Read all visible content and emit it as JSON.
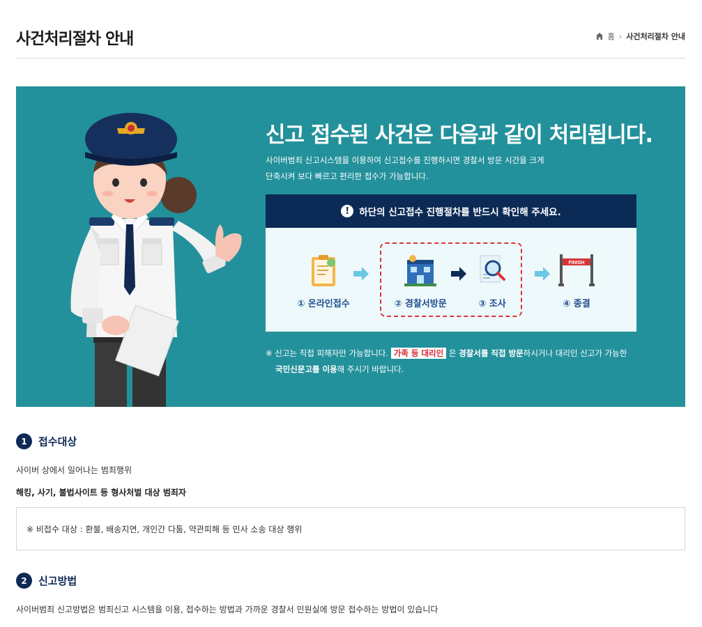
{
  "header": {
    "title": "사건처리절차 안내",
    "breadcrumb": {
      "home": "홈",
      "current": "사건처리절차 안내"
    }
  },
  "banner": {
    "title": "신고 접수된 사건은 다음과 같이 처리됩니다.",
    "desc_line1": "사이버범죄 신고시스템을 이용하여 신고접수를 진행하시면 경찰서 방문 시간을 크게",
    "desc_line2": "단축시켜 보다 빠르고 편리한 접수가 가능합니다.",
    "process_notice": "하단의 신고접수 진행절차를 반드시 확인해 주세요.",
    "alert_glyph": "!",
    "steps": [
      {
        "label": "① 온라인접수",
        "icon": "clipboard-icon"
      },
      {
        "label": "② 경찰서방문",
        "icon": "police-station-icon"
      },
      {
        "label": "③ 조사",
        "icon": "magnifier-document-icon"
      },
      {
        "label": "④ 종결",
        "icon": "finish-line-icon"
      }
    ],
    "finish_text": "FINISH",
    "note": {
      "part1": "※ 신고는 직접 피해자만 가능합니다.",
      "highlight": "가족 등 대리인",
      "part2": "은",
      "bold1": "경찰서를 직접 방문",
      "part3": "하시거나 대리인 신고가 가능한",
      "bold2": "국민신문고를 이용",
      "part4": "해 주시기 바랍니다."
    },
    "colors": {
      "background": "#23919b",
      "navy": "#0b2a55",
      "red": "#d8343a",
      "light": "#eef9fb"
    }
  },
  "section1": {
    "num": "1",
    "title": "접수대상",
    "line1": "사이버 상에서 일어나는 범죄행위",
    "line2": "해킹, 사기, 불법사이트 등 형사처벌 대상 범죄자",
    "notice": "※ 비접수 대상 : 환불, 배송지연, 개인간 다툼, 약관피해 등 민사 소송 대상 행위"
  },
  "section2": {
    "num": "2",
    "title": "신고방법",
    "line1": "사이버범죄 신고방법은 범죄신고 시스템을 이용, 접수하는 방법과 가까운 경찰서 민원실에 방문 접수하는 방법이 있습니다"
  }
}
